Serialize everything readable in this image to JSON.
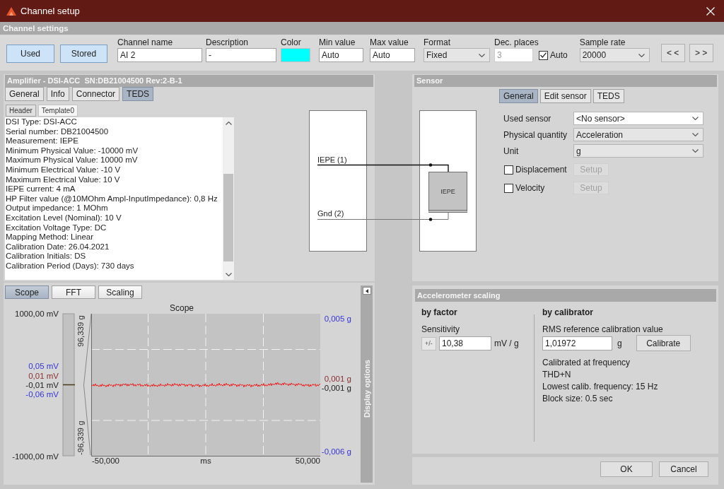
{
  "window": {
    "title": "Channel setup"
  },
  "channel_settings": {
    "title": "Channel settings",
    "toggles": [
      {
        "label": "Used",
        "on": true
      },
      {
        "label": "Stored",
        "on": true
      }
    ],
    "fields": [
      {
        "kind": "text",
        "label": "Channel name",
        "value": "AI 2",
        "disabled": false
      },
      {
        "kind": "text",
        "label": "Description",
        "value": "-",
        "disabled": false
      },
      {
        "kind": "color",
        "label": "Color",
        "color": "#00ffff",
        "disabled": false
      },
      {
        "kind": "text",
        "label": "Min value",
        "value": "Auto",
        "disabled": false
      },
      {
        "kind": "text",
        "label": "Max value",
        "value": "Auto",
        "disabled": false
      },
      {
        "kind": "dropdown",
        "label": "Format",
        "value": "Fixed",
        "disabled": false
      },
      {
        "kind": "text",
        "label": "Dec. places",
        "value": "3",
        "disabled": true,
        "checkbox": {
          "label": "Auto",
          "checked": true
        }
      },
      {
        "kind": "dropdown",
        "label": "Sample rate",
        "value": "20000",
        "disabled": false
      }
    ],
    "nav_buttons": [
      "< <",
      "> >"
    ]
  },
  "amplifier": {
    "title": "Amplifier - DSI-ACC  SN:DB21004500 Rev:2-B-1",
    "tabs": [
      {
        "label": "General",
        "selected": false
      },
      {
        "label": "Info",
        "selected": false
      },
      {
        "label": "Connector",
        "selected": false
      },
      {
        "label": "TEDS",
        "selected": true
      }
    ],
    "subtabs": [
      {
        "label": "Header",
        "selected": false
      },
      {
        "label": "Template0",
        "selected": true
      }
    ],
    "teds_lines": [
      "DSI Type: DSI-ACC",
      "Serial number: DB21004500",
      "Measurement: IEPE",
      "Minimum Physical Value: -10000 mV",
      "Maximum Physical Value: 10000 mV",
      "Minimum Electrical Value: -10 V",
      "Maximum Electrical Value: 10 V",
      "IEPE current: 4 mA",
      "HP Filter value (@10MOhm Ampl-InputImpedance): 0,8 Hz",
      "Output impedance: 1 MOhm",
      "Excitation Level (Nominal): 10 V",
      "Excitation Voltage Type: DC",
      "Mapping Method: Linear",
      "Calibration Date: 26.04.2021",
      "Calibration Initials: DS",
      "Calibration Period (Days): 730 days"
    ],
    "pins": [
      "IEPE (1)",
      "Gnd (2)"
    ]
  },
  "sensor": {
    "title": "Sensor",
    "tabs": [
      {
        "label": "General",
        "selected": true
      },
      {
        "label": "Edit sensor",
        "selected": false
      },
      {
        "label": "TEDS",
        "selected": false
      }
    ],
    "block_label": "IEPE",
    "fields": [
      {
        "label": "Used sensor",
        "value": "<No sensor>",
        "editable": true
      },
      {
        "label": "Physical quantity",
        "value": "Acceleration",
        "editable": false
      },
      {
        "label": "Unit",
        "value": "g",
        "editable": false
      }
    ],
    "options": [
      {
        "label": "Displacement",
        "checked": false,
        "button": {
          "label": "Setup",
          "disabled": true
        }
      },
      {
        "label": "Velocity",
        "checked": false,
        "button": {
          "label": "Setup",
          "disabled": true
        }
      }
    ]
  },
  "scope": {
    "tabs": [
      {
        "label": "Scope",
        "selected": true
      },
      {
        "label": "FFT",
        "selected": false
      },
      {
        "label": "Scaling",
        "selected": false
      }
    ],
    "side_panel": "Display options",
    "chart": {
      "title": "Scope",
      "left_axis_labels": [
        "1000,00 mV",
        "-1000,00 mV"
      ],
      "left_readings": [
        {
          "text": "0,05 mV",
          "color": "#3535dd"
        },
        {
          "text": "0,01 mV",
          "color": "#8a3030"
        },
        {
          "text": "-0,01 mV",
          "color": "#222222"
        },
        {
          "text": "-0,06 mV",
          "color": "#3535dd"
        }
      ],
      "gauge": {
        "level": 0.5,
        "labels": [
          "96,339 g",
          "-96,339 g"
        ]
      },
      "right_readings": [
        {
          "text": "0,005 g",
          "color": "#3535dd"
        },
        {
          "text": "0,001 g",
          "color": "#8a3030"
        },
        {
          "text": "-0,001 g",
          "color": "#222222"
        },
        {
          "text": "-0,006 g",
          "color": "#3535dd"
        }
      ],
      "x_labels": [
        "-50,000",
        "ms",
        "50,000"
      ]
    }
  },
  "accelerometer_scaling": {
    "title": "Accelerometer scaling",
    "by_factor": {
      "heading": "by factor",
      "label": "Sensitivity",
      "sign_button": "+/-",
      "value": "10,38",
      "unit": "mV / g"
    },
    "by_calibrator": {
      "heading": "by calibrator",
      "label": "RMS reference calibration value",
      "value": "1,01972",
      "unit": "g",
      "button": "Calibrate",
      "info": [
        "Calibrated at frequency",
        "THD+N",
        "Lowest calib. frequency: 15 Hz",
        "Block size: 0.5 sec"
      ]
    }
  },
  "buttons": [
    "OK",
    "Cancel"
  ]
}
